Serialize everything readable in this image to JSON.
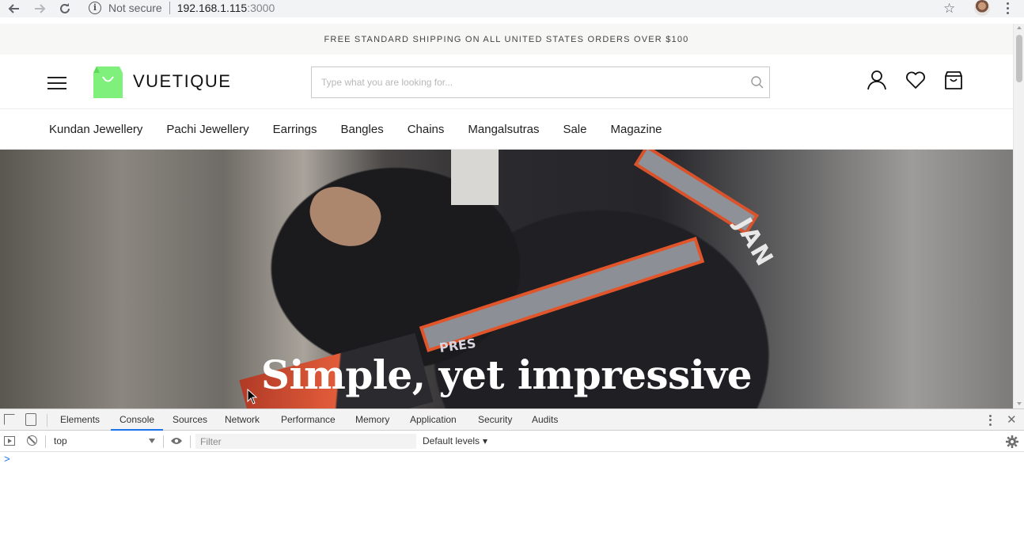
{
  "browser": {
    "security_label": "Not secure",
    "url_host": "192.168.1.115",
    "url_port": ":3000"
  },
  "site": {
    "promo": "FREE STANDARD SHIPPING ON ALL UNITED STATES ORDERS OVER $100",
    "brand": "VUETIQUE",
    "brand_color": "#7ef07b",
    "search_placeholder": "Type what you are looking for...",
    "nav": [
      "Kundan Jewellery",
      "Pachi Jewellery",
      "Earrings",
      "Bangles",
      "Chains",
      "Mangalsutras",
      "Sale",
      "Magazine"
    ],
    "hero_headline": "Simple, yet impressive",
    "hero_jacket_text": "JAN",
    "hero_badge_text": "PRES"
  },
  "devtools": {
    "tabs": [
      "Elements",
      "Console",
      "Sources",
      "Network",
      "Performance",
      "Memory",
      "Application",
      "Security",
      "Audits"
    ],
    "active_tab": "Console",
    "context": "top",
    "filter_placeholder": "Filter",
    "levels": "Default levels",
    "prompt": ">"
  }
}
